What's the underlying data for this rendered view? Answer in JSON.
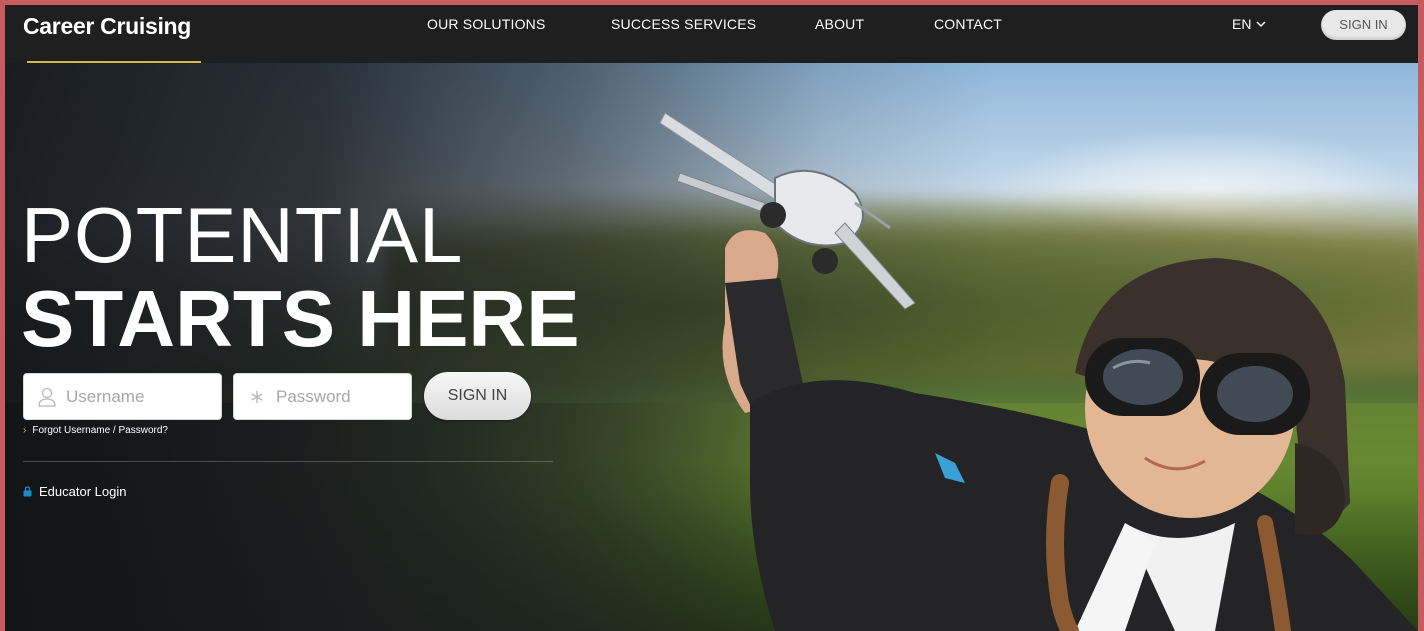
{
  "header": {
    "brand": "Career Cruising",
    "nav": [
      {
        "label": "OUR SOLUTIONS"
      },
      {
        "label": "SUCCESS SERVICES"
      },
      {
        "label": "ABOUT"
      },
      {
        "label": "CONTACT"
      }
    ],
    "language": "EN",
    "signin_label": "SIGN IN"
  },
  "hero": {
    "headline_line1": "POTENTIAL",
    "headline_line2": "STARTS HERE",
    "username_placeholder": "Username",
    "password_placeholder": "Password",
    "signin_label": "SIGN IN",
    "forgot_link": "Forgot Username / Password?",
    "educator_link": "Educator Login"
  },
  "icons": {
    "user": "user-icon",
    "password": "asterisk-icon",
    "chevron": "chevron-down-icon",
    "forgot": "chevron-right-icon",
    "lock": "lock-icon"
  },
  "colors": {
    "nav_bg": "#1f1f1f",
    "accent": "#d8b64a",
    "educator_icon": "#1e88c9",
    "frame_border": "#c75a5e"
  }
}
